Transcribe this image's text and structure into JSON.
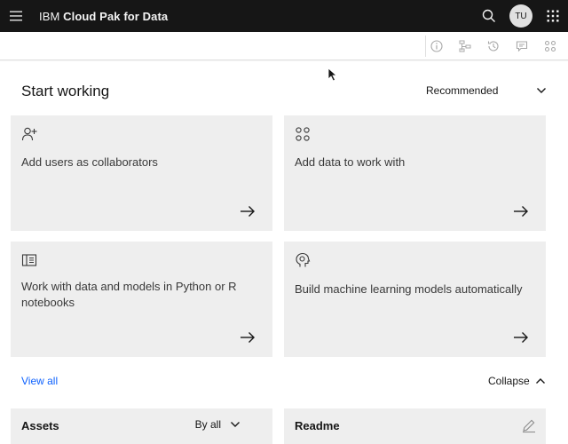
{
  "header": {
    "brand_prefix": "IBM",
    "brand_product": "Cloud Pak for Data",
    "avatar_initials": "TU",
    "icons": [
      "hamburger-menu-icon",
      "search-icon",
      "app-switcher-icon"
    ]
  },
  "toolbar": {
    "icons": [
      "info-icon",
      "flow-icon",
      "history-icon",
      "chat-icon",
      "settings-adjust-icon"
    ]
  },
  "start_working": {
    "title": "Start working",
    "filter_label": "Recommended",
    "tiles": [
      {
        "label": "Add users as collaborators",
        "icon": "user-add-icon"
      },
      {
        "label": "Add data to work with",
        "icon": "data-icon"
      },
      {
        "label": "Work with data and models in Python or R notebooks",
        "icon": "notebook-icon"
      },
      {
        "label": "Build machine learning models automatically",
        "icon": "ml-brain-icon"
      }
    ],
    "view_all_label": "View all",
    "collapse_label": "Collapse"
  },
  "assets": {
    "title": "Assets",
    "filter_label": "By all"
  },
  "readme": {
    "title": "Readme"
  },
  "colors": {
    "header_bg": "#161616",
    "link": "#0f62fe",
    "tile_bg": "#eeeeee"
  }
}
